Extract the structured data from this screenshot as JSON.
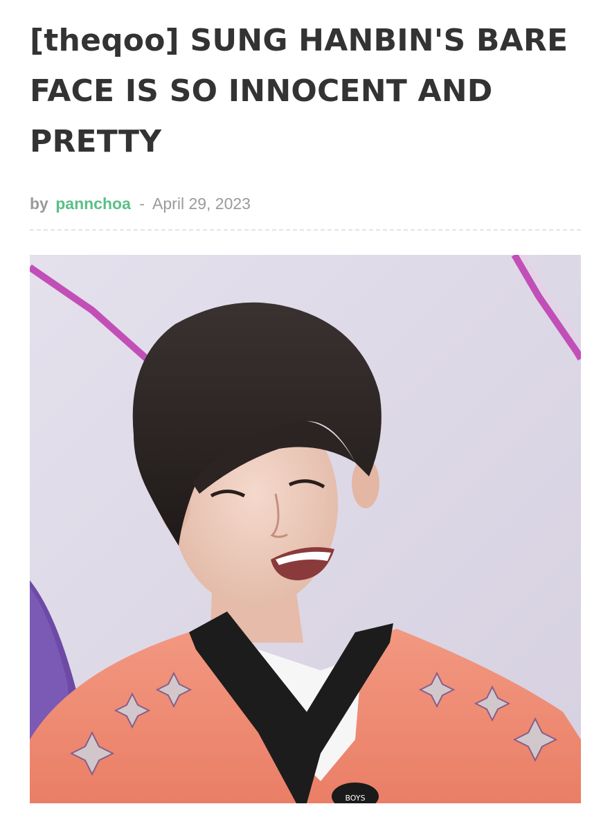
{
  "article": {
    "title": "[theqoo] SUNG HANBIN'S BARE FACE IS SO INNOCENT AND PRETTY",
    "byline_prefix": "by",
    "author": "pannchoa",
    "separator": "-",
    "date": "April 29, 2023"
  },
  "photo": {
    "subject": "young man with dark bowl-cut hair, smiling, wearing coral jersey with black V collar",
    "mic_text": "BOYS"
  },
  "colors": {
    "title": "#333333",
    "author_link": "#5bbf87",
    "meta_text": "#9a9a9a",
    "divider": "#e3e3e3",
    "background_wall": "#ddd7e6",
    "accent_stripe": "#c24fb8",
    "jersey": "#f08a72"
  }
}
